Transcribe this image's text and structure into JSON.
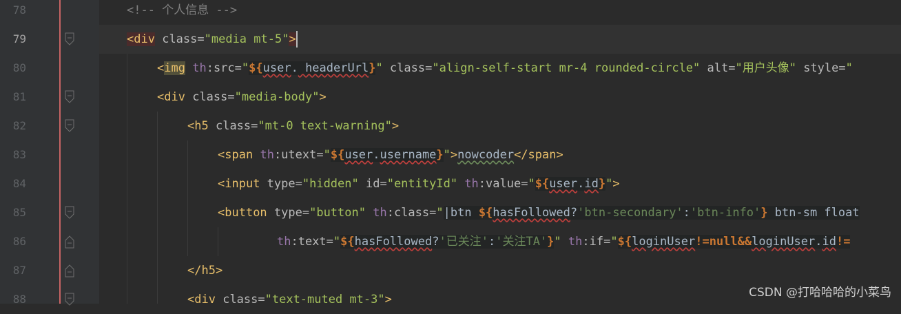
{
  "editor": {
    "lines": [
      {
        "num": "78",
        "parts": [
          "<!-- 个人信息 -->"
        ]
      },
      {
        "num": "79",
        "parts": [
          "<",
          "div",
          " class=",
          "\"media mt-5\"",
          ">"
        ]
      },
      {
        "num": "80",
        "parts": [
          "<",
          "img",
          " ",
          "th",
          ":src=",
          "\"",
          "${",
          "user",
          ".",
          " headerUrl",
          "}",
          "\"",
          " class=",
          "\"align-self-start mr-4 rounded-circle\"",
          " alt=",
          "\"用户头像\"",
          " style=",
          "\""
        ]
      },
      {
        "num": "81",
        "parts": [
          "<",
          "div",
          " class=",
          "\"media-body\"",
          ">"
        ]
      },
      {
        "num": "82",
        "parts": [
          "<",
          "h5",
          " class=",
          "\"mt-0 text-warning\"",
          ">"
        ]
      },
      {
        "num": "83",
        "parts": [
          "<",
          "span",
          " ",
          "th",
          ":utext=",
          "\"",
          "${",
          "user",
          ".",
          "username",
          "}",
          "\"",
          ">",
          "nowcoder",
          "</",
          "span",
          ">"
        ]
      },
      {
        "num": "84",
        "parts": [
          "<",
          "input",
          " type=",
          "\"hidden\"",
          " id=",
          "\"entityId\"",
          " ",
          "th",
          ":value=",
          "\"",
          "${",
          "user",
          ".",
          "id",
          "}",
          "\"",
          ">"
        ]
      },
      {
        "num": "85",
        "parts": [
          "<",
          "button",
          " type=",
          "\"button\"",
          " ",
          "th",
          ":class=",
          "\"",
          "|btn ",
          "${",
          "hasFollowed",
          "?",
          "'btn-secondary'",
          ":",
          "'btn-info'",
          "}",
          " btn-sm float"
        ]
      },
      {
        "num": "86",
        "parts": [
          "th",
          ":text=",
          "\"",
          "${",
          "hasFollowed",
          "?",
          "'已关注'",
          ":",
          "'关注TA'",
          "}",
          "\"",
          " ",
          "th",
          ":if=",
          "\"",
          "${",
          "loginUser",
          "!=",
          "null",
          "&&",
          "loginUser",
          ".",
          "id",
          "!="
        ]
      },
      {
        "num": "87",
        "parts": [
          "</",
          "h5",
          ">"
        ]
      },
      {
        "num": "88",
        "parts": [
          "<",
          "div",
          " class=",
          "\"text-muted mt-3\"",
          ">"
        ]
      }
    ]
  },
  "watermark": "CSDN @打哈哈哈的小菜鸟"
}
